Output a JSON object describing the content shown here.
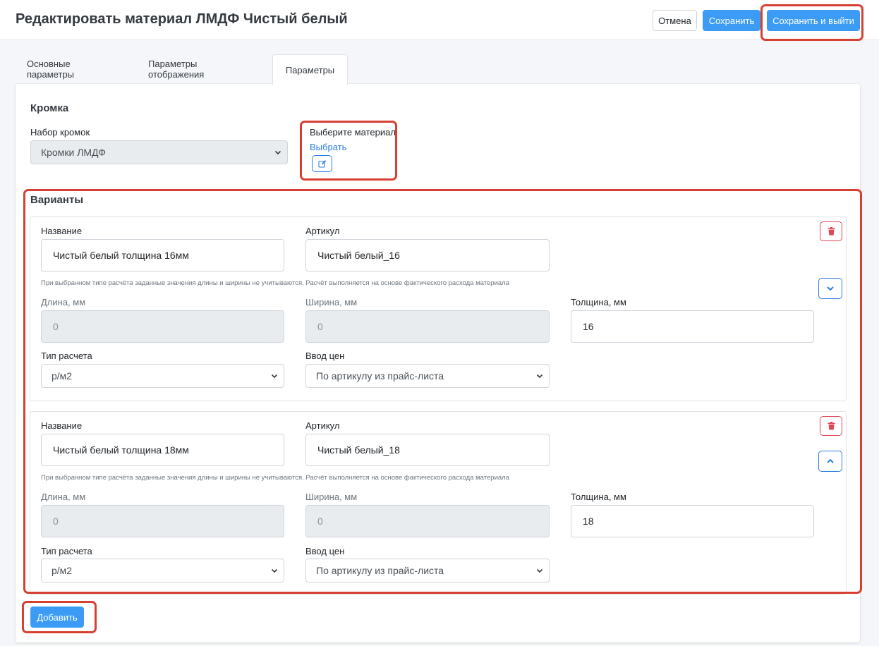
{
  "header": {
    "title": "Редактировать материал ЛМДФ Чистый белый",
    "cancel_label": "Отмена",
    "save_label": "Сохранить",
    "save_exit_label": "Сохранить и выйти"
  },
  "tabs": [
    {
      "label": "Основные параметры",
      "active": false
    },
    {
      "label": "Параметры отображения",
      "active": false
    },
    {
      "label": "Параметры",
      "active": true
    }
  ],
  "edge": {
    "section_title": "Кромка",
    "set_label": "Набор кромок",
    "set_value": "Кромки ЛМДФ",
    "material_label": "Выберите материал",
    "choose_link": "Выбрать"
  },
  "variants_section": {
    "title": "Варианты",
    "add_label": "Добавить"
  },
  "variants": [
    {
      "name_label": "Название",
      "name_value": "Чистый белый толщина 16мм",
      "article_label": "Артикул",
      "article_value": "Чистый белый_16",
      "hint": "При выбранном типе расчёта заданные значения длины и ширины не учитываются. Расчёт выполняется на основе фактического расхода материала",
      "length_label": "Длина, мм",
      "length_value": "0",
      "width_label": "Ширина, мм",
      "width_value": "0",
      "thickness_label": "Толщина, мм",
      "thickness_value": "16",
      "calc_label": "Тип расчета",
      "calc_value": "р/м2",
      "price_label": "Ввод цен",
      "price_value": "По артикулу из прайс-листа",
      "move_icon": "chevron-down-icon"
    },
    {
      "name_label": "Название",
      "name_value": "Чистый белый толщина 18мм",
      "article_label": "Артикул",
      "article_value": "Чистый белый_18",
      "hint": "При выбранном типе расчёта заданные значения длины и ширины не учитываются. Расчёт выполняется на основе фактического расхода материала",
      "length_label": "Длина, мм",
      "length_value": "0",
      "width_label": "Ширина, мм",
      "width_value": "0",
      "thickness_label": "Толщина, мм",
      "thickness_value": "18",
      "calc_label": "Тип расчета",
      "calc_value": "р/м2",
      "price_label": "Ввод цен",
      "price_value": "По артикулу из прайс-листа",
      "move_icon": "chevron-up-icon"
    }
  ],
  "colors": {
    "primary": "#3c9cf5",
    "link": "#2a7de1",
    "danger": "#e04857",
    "highlight": "#d64032"
  }
}
